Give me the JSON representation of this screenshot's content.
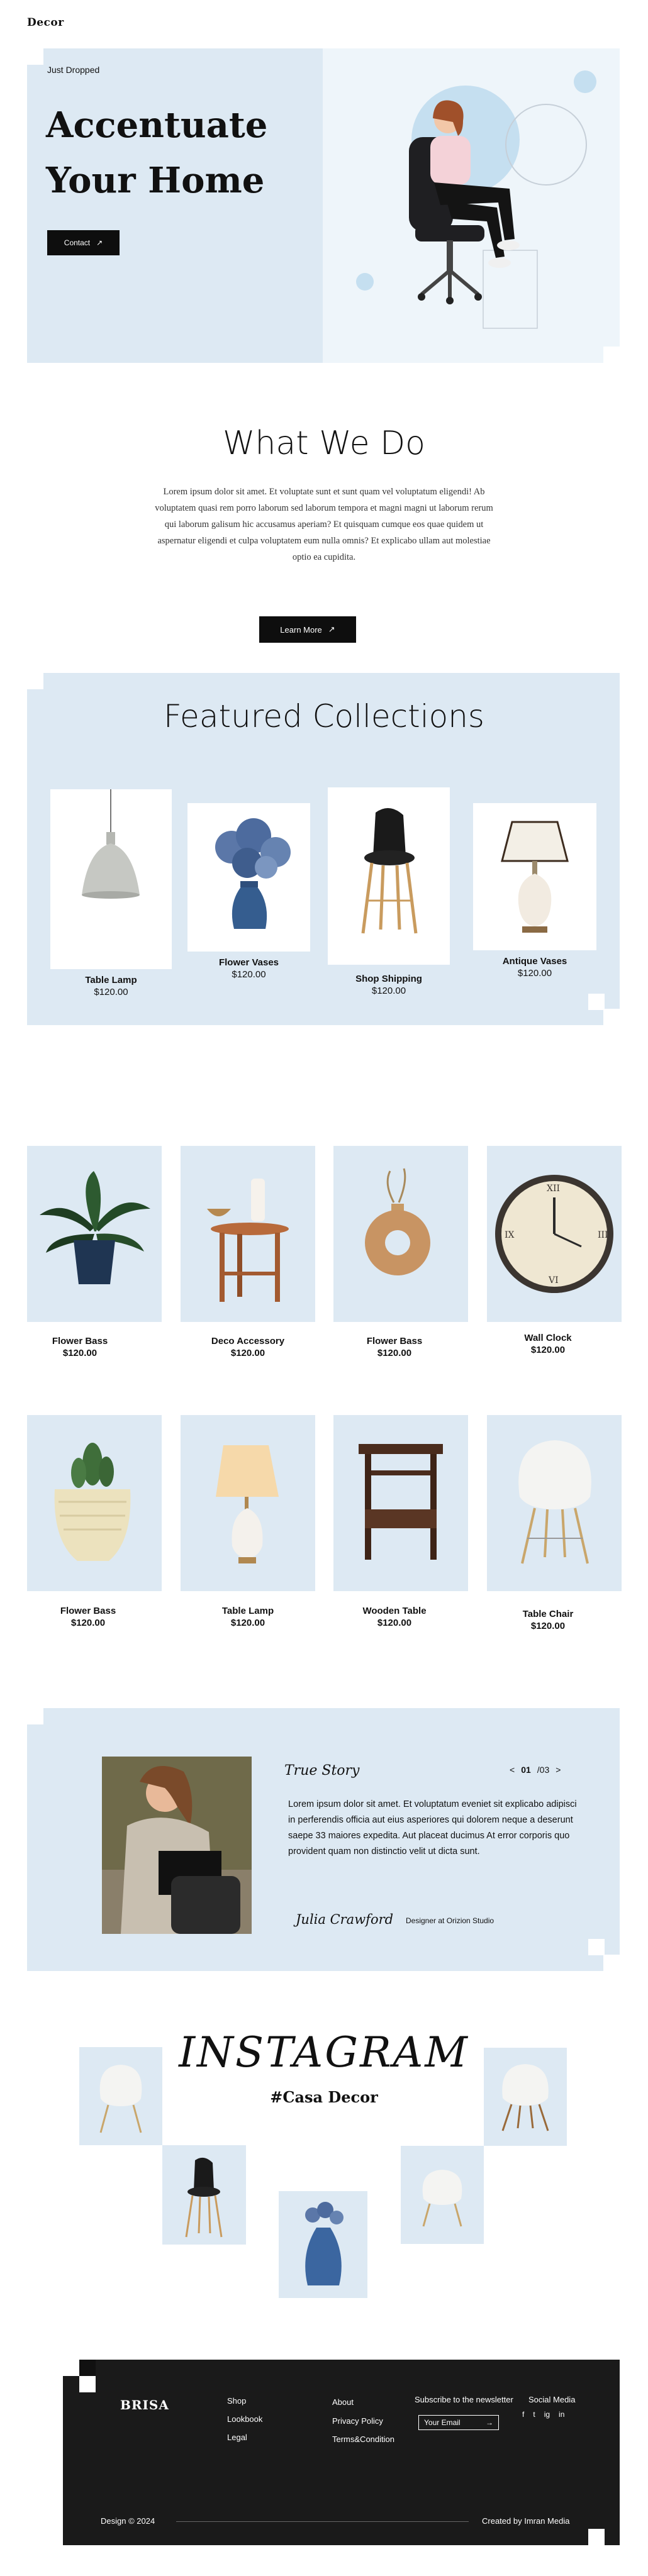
{
  "header": {
    "logo": "Decor"
  },
  "hero": {
    "eyebrow": "Just Dropped",
    "title": "Accentuate Your Home",
    "button": "Contact"
  },
  "what_we_do": {
    "title": "What We Do",
    "text": "Lorem ipsum dolor sit amet. Et voluptate sunt et sunt quam vel voluptatum eligendi! Ab voluptatem quasi rem porro laborum sed laborum tempora et magni magni ut laborum rerum qui laborum galisum hic accusamus aperiam? Et quisquam cumque eos quae quidem ut aspernatur eligendi et culpa voluptatem eum nulla omnis? Et explicabo ullam aut molestiae optio ea cupidita.",
    "button": "Learn More"
  },
  "featured": {
    "title": "Featured Collections",
    "items": [
      {
        "name": "Table Lamp",
        "price": "$120.00",
        "icon": "pendant-lamp-icon"
      },
      {
        "name": "Flower Vases",
        "price": "$120.00",
        "icon": "flower-vase-icon"
      },
      {
        "name": "Shop Shipping",
        "price": "$120.00",
        "icon": "stool-chair-icon"
      },
      {
        "name": "Antique Vases",
        "price": "$120.00",
        "icon": "table-lamp-icon"
      }
    ]
  },
  "products": [
    {
      "name": "Flower Bass",
      "price": "$120.00",
      "icon": "potted-plant-icon"
    },
    {
      "name": "Deco Accessory",
      "price": "$120.00",
      "icon": "side-table-icon"
    },
    {
      "name": "Flower Bass",
      "price": "$120.00",
      "icon": "ring-vase-icon"
    },
    {
      "name": "Wall Clock",
      "price": "$120.00",
      "icon": "wall-clock-icon"
    },
    {
      "name": "Flower Bass",
      "price": "$120.00",
      "icon": "cactus-pot-icon"
    },
    {
      "name": "Table Lamp",
      "price": "$120.00",
      "icon": "table-lamp-icon"
    },
    {
      "name": "Wooden Table",
      "price": "$120.00",
      "icon": "wooden-table-icon"
    },
    {
      "name": "Table Chair",
      "price": "$120.00",
      "icon": "white-chair-icon"
    }
  ],
  "story": {
    "title": "True Story",
    "page_current": "01",
    "page_total": "/03",
    "text": "Lorem ipsum dolor sit amet. Et voluptatum eveniet sit explicabo adipisci in perferendis officia aut eius asperiores qui dolorem neque a deserunt saepe 33 maiores expedita. Aut placeat ducimus At error corporis quo provident quam non distinctio velit ut dicta sunt.",
    "author": "Julia Crawford",
    "role": "Designer at Orizion Studio"
  },
  "instagram": {
    "title": "INSTAGRAM",
    "tag": "#Casa Decor"
  },
  "footer": {
    "brand": "BRISA",
    "col1": [
      "Shop",
      "Lookbook",
      "Legal"
    ],
    "col2": [
      "About",
      "Privacy Policy",
      "Terms&Condition"
    ],
    "newsletter_label": "Subscribe to the newsletter",
    "email_placeholder": "Your Email",
    "social_label": "Social Media",
    "social": [
      "f",
      "t",
      "ig",
      "in"
    ],
    "copyright": "Design © 2024",
    "credit": "Created by Imran Media"
  },
  "colors": {
    "accent_blue": "#dde9f3",
    "dark": "#111111"
  }
}
